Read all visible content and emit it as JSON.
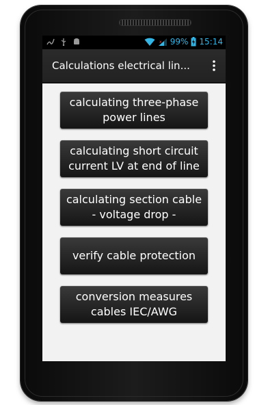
{
  "status_bar": {
    "battery_percent": "99%",
    "time": "15:14",
    "left_icons": [
      "signature-icon",
      "usb-icon",
      "android-icon"
    ],
    "right_icons": [
      "wifi-icon",
      "signal-icon",
      "battery-icon"
    ],
    "accent_color": "#33b5e5"
  },
  "action_bar": {
    "title": "Calculations electrical lin...",
    "overflow_icon": "overflow-menu-icon"
  },
  "menu": {
    "items": [
      {
        "label": "calculating three-phase\npower lines"
      },
      {
        "label": "calculating short circuit\ncurrent LV at end of line"
      },
      {
        "label": "calculating section cable\n- voltage drop -"
      },
      {
        "label": "verify cable protection"
      },
      {
        "label": "conversion measures\ncables IEC/AWG"
      }
    ]
  }
}
